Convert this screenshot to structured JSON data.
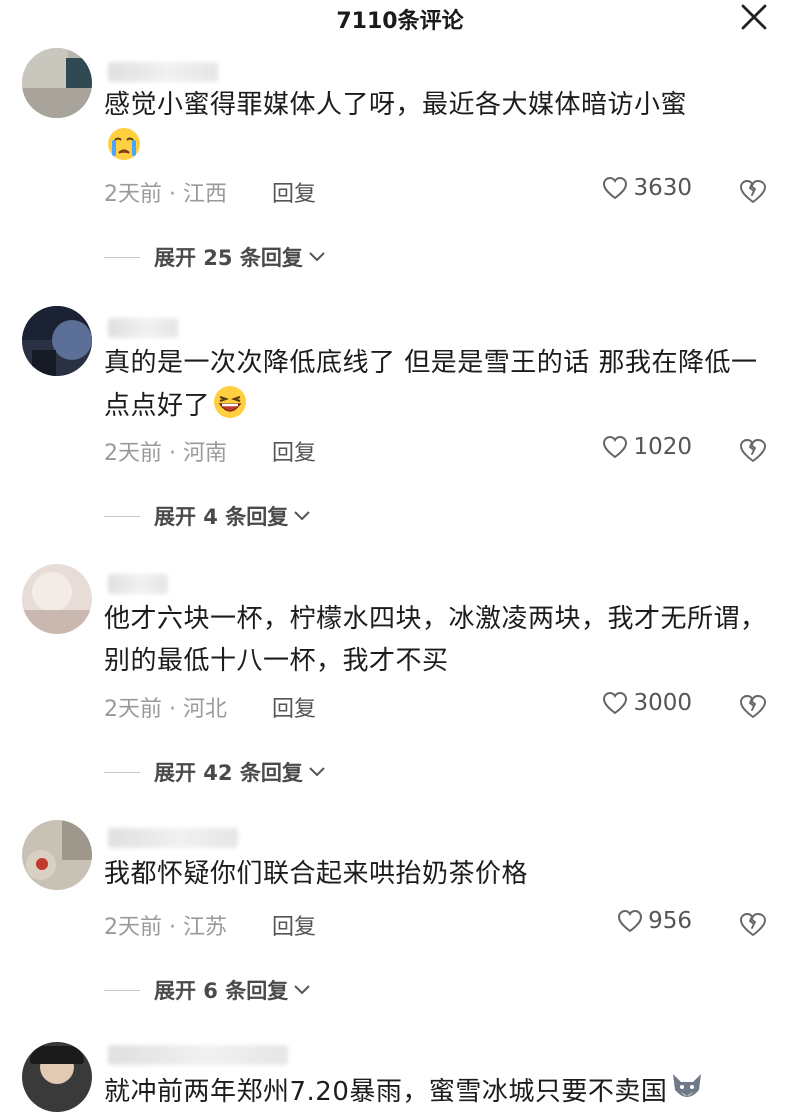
{
  "header": {
    "title": "7110条评论"
  },
  "comments": [
    {
      "text": "感觉小蜜得罪媒体人了呀，最近各大媒体暗访小蜜",
      "time_location": "2天前 · 江西",
      "reply_label": "回复",
      "likes": "3630",
      "expand_label": "展开 25 条回复",
      "emoji": "crying-face-emoji"
    },
    {
      "text": "真的是一次次降低底线了 但是是雪王的话 那我在降低一点点好了",
      "time_location": "2天前 · 河南",
      "reply_label": "回复",
      "likes": "1020",
      "expand_label": "展开 4 条回复",
      "emoji": "laughing-face-emoji"
    },
    {
      "text": "他才六块一杯，柠檬水四块，冰激凌两块，我才无所谓，别的最低十八一杯，我才不买",
      "time_location": "2天前 · 河北",
      "reply_label": "回复",
      "likes": "3000",
      "expand_label": "展开 42 条回复"
    },
    {
      "text": "我都怀疑你们联合起来哄抬奶茶价格",
      "time_location": "2天前 · 江苏",
      "reply_label": "回复",
      "likes": "956",
      "expand_label": "展开 6 条回复"
    },
    {
      "text": "就冲前两年郑州7.20暴雨，蜜雪冰城只要不卖国",
      "emoji": "wolf-face-emoji"
    }
  ],
  "colors": {
    "meta": "#9a9a9a",
    "text": "#1c1c1c",
    "icon": "#6b6b6b"
  }
}
